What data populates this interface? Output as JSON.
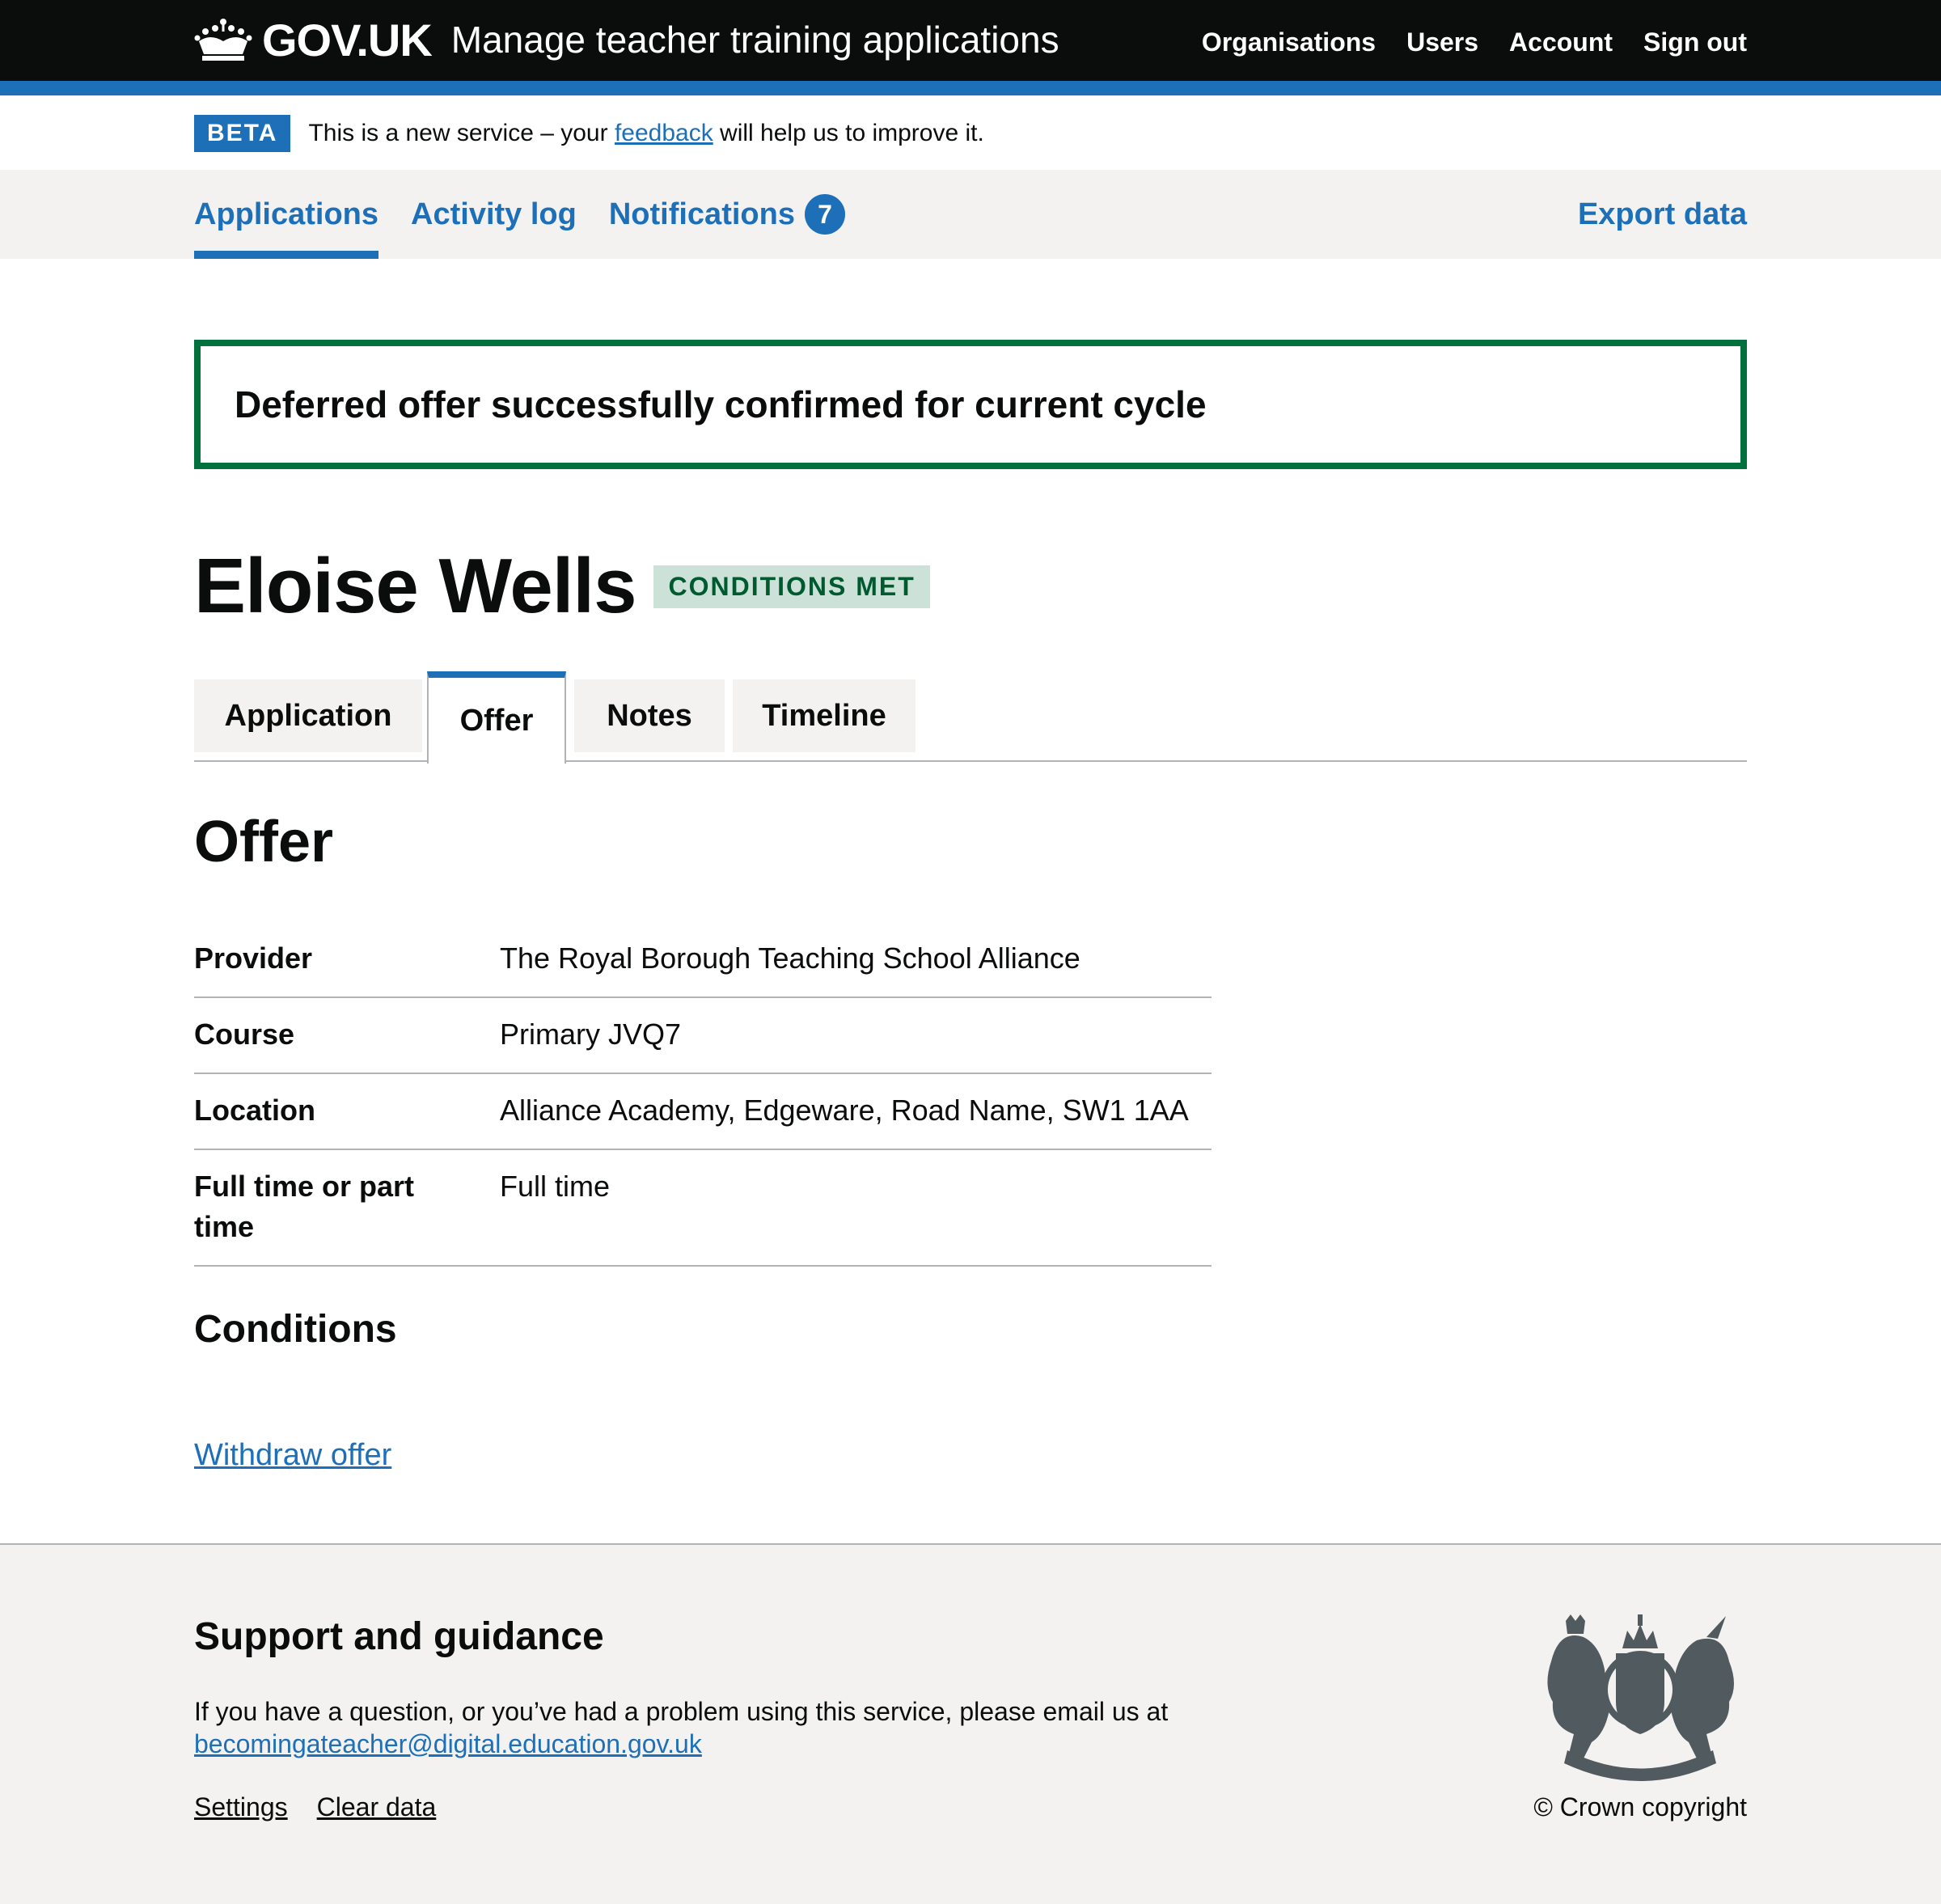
{
  "header": {
    "logo_text": "GOV.UK",
    "service_name": "Manage teacher training applications",
    "nav": [
      "Organisations",
      "Users",
      "Account",
      "Sign out"
    ]
  },
  "beta": {
    "tag": "BETA",
    "text_before": "This is a new service – your ",
    "link": "feedback",
    "text_after": " will help us to improve it."
  },
  "primary_nav": {
    "items": [
      "Applications",
      "Activity log",
      "Notifications"
    ],
    "notifications_count": "7",
    "export": "Export data",
    "active": "Applications"
  },
  "success_banner": "Deferred offer successfully confirmed for current cycle",
  "candidate": {
    "name": "Eloise Wells",
    "status": "CONDITIONS MET"
  },
  "tabs": [
    "Application",
    "Offer",
    "Notes",
    "Timeline"
  ],
  "offer": {
    "title": "Offer",
    "rows": [
      {
        "key": "Provider",
        "value": "The Royal Borough Teaching School Alliance"
      },
      {
        "key": "Course",
        "value": "Primary JVQ7"
      },
      {
        "key": "Location",
        "value": "Alliance Academy, Edgeware, Road Name, SW1 1AA"
      },
      {
        "key": "Full time or part time",
        "value": "Full time"
      }
    ],
    "conditions_title": "Conditions",
    "withdraw_link": "Withdraw offer"
  },
  "footer": {
    "title": "Support and guidance",
    "text": "If you have a question, or you’ve had a problem using this service, please email us at",
    "email": "becomingateacher@digital.education.gov.uk",
    "links": [
      "Settings",
      "Clear data"
    ],
    "copyright": "© Crown copyright"
  },
  "colors": {
    "header_bg": "#0b0c0c",
    "brand_blue": "#1d70b8",
    "success_green": "#00703c",
    "tag_green_bg": "#cce2d8",
    "tag_green_text": "#005a30",
    "grey_bg": "#f3f2f1"
  }
}
